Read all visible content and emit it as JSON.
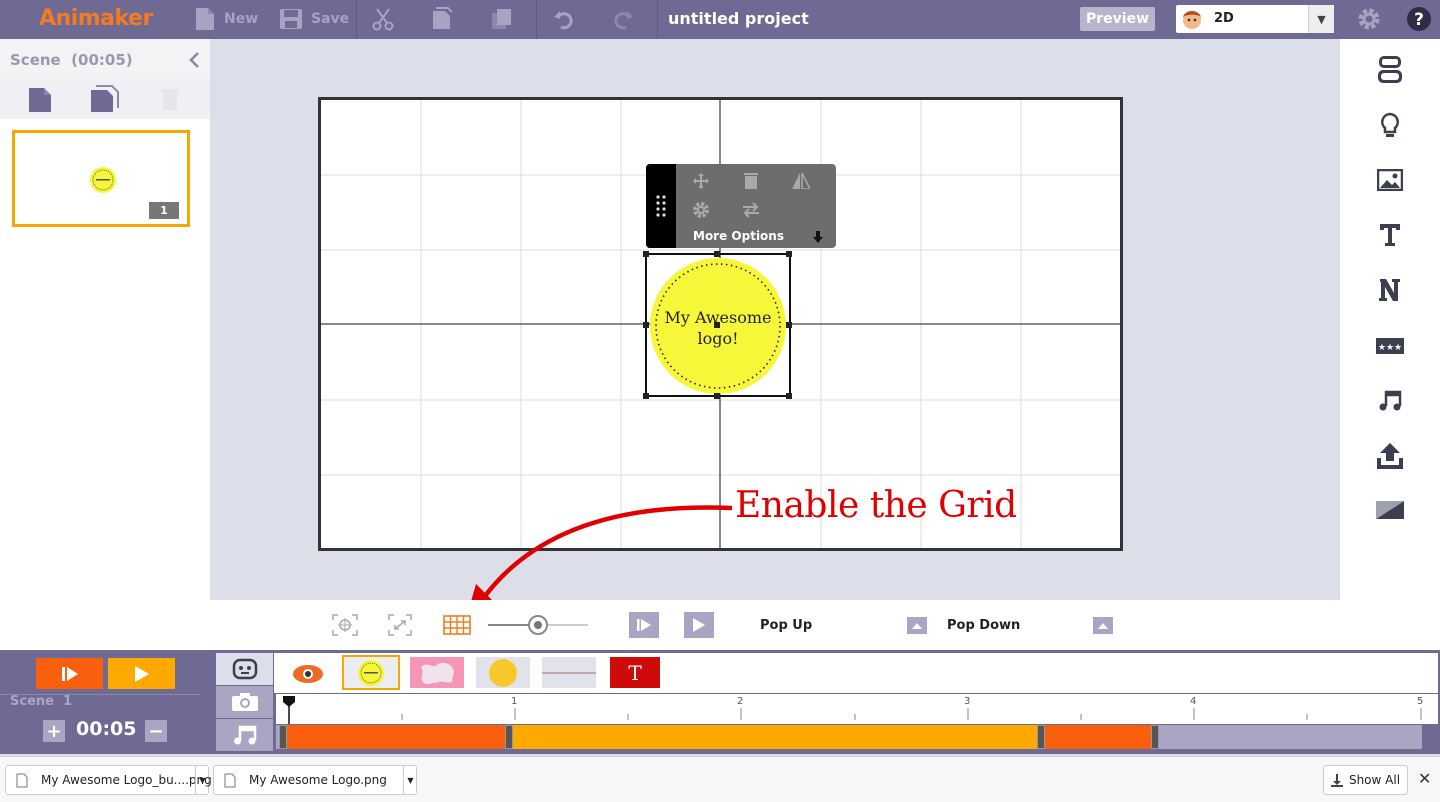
{
  "app": {
    "logo": "Animaker",
    "project_title": "untitled project"
  },
  "toolbar": {
    "new_label": "New",
    "save_label": "Save",
    "preview_label": "Preview",
    "mode": "2D"
  },
  "scene_panel": {
    "title": "Scene  (00:05)",
    "thumb_number": "1"
  },
  "stage": {
    "logo_text_line1": "My Awesome",
    "logo_text_line2": "logo!",
    "more_options": "More Options",
    "annotation": "Enable the Grid"
  },
  "bottom_bar": {
    "pop_up": "Pop Up",
    "pop_down": "Pop Down"
  },
  "timeline": {
    "scene_label": "Scene  1",
    "duration": "00:05",
    "ruler_marks": [
      "1",
      "2",
      "3",
      "4",
      "5"
    ]
  },
  "downloads": {
    "item1": "My Awesome Logo_bu....png",
    "item2": "My Awesome Logo.png",
    "show_all": "Show All"
  },
  "colors": {
    "accent_orange": "#f95f0c",
    "accent_yellow": "#fda900",
    "topbar": "#6f6a93",
    "annotation_red": "#e00000"
  }
}
